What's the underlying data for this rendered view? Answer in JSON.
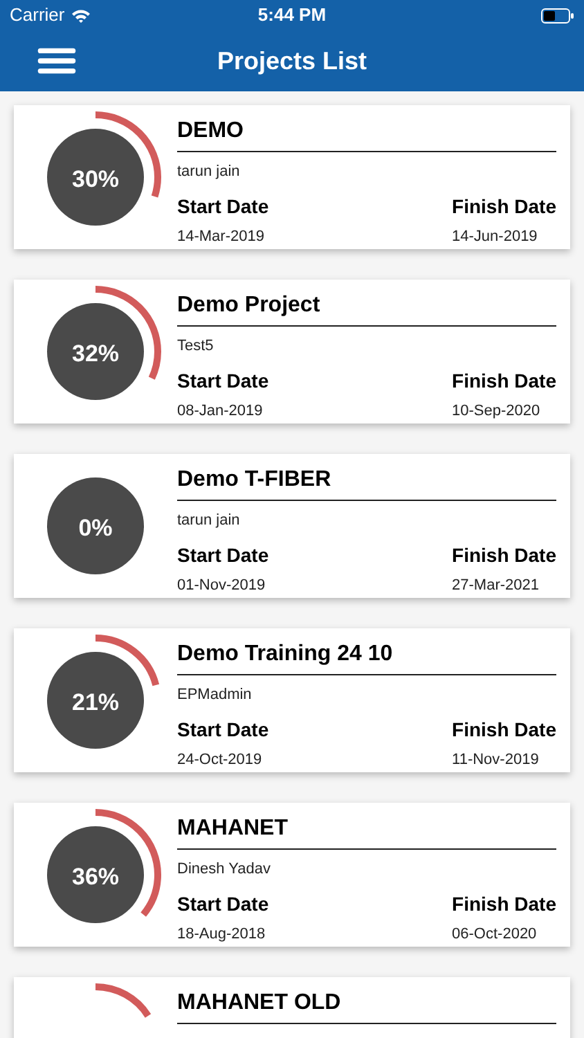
{
  "status_bar": {
    "carrier": "Carrier",
    "time": "5:44 PM"
  },
  "nav_bar": {
    "title": "Projects List"
  },
  "projects": [
    {
      "name": "DEMO",
      "owner": "tarun jain",
      "percent": "30%",
      "start_label": "Start Date",
      "start": "14-Mar-2019",
      "finish_label": "Finish Date",
      "finish": "14-Jun-2019"
    },
    {
      "name": "Demo Project",
      "owner": "Test5",
      "percent": "32%",
      "start_label": "Start Date",
      "start": "08-Jan-2019",
      "finish_label": "Finish Date",
      "finish": "10-Sep-2020"
    },
    {
      "name": "Demo T-FIBER",
      "owner": "tarun jain",
      "percent": "0%",
      "start_label": "Start Date",
      "start": "01-Nov-2019",
      "finish_label": "Finish Date",
      "finish": "27-Mar-2021"
    },
    {
      "name": "Demo Training 24 10",
      "owner": "EPMadmin",
      "percent": "21%",
      "start_label": "Start Date",
      "start": "24-Oct-2019",
      "finish_label": "Finish Date",
      "finish": "11-Nov-2019"
    },
    {
      "name": "MAHANET",
      "owner": "Dinesh Yadav",
      "percent": "36%",
      "start_label": "Start Date",
      "start": "18-Aug-2018",
      "finish_label": "Finish Date",
      "finish": "06-Oct-2020"
    },
    {
      "name": "MAHANET OLD"
    }
  ]
}
